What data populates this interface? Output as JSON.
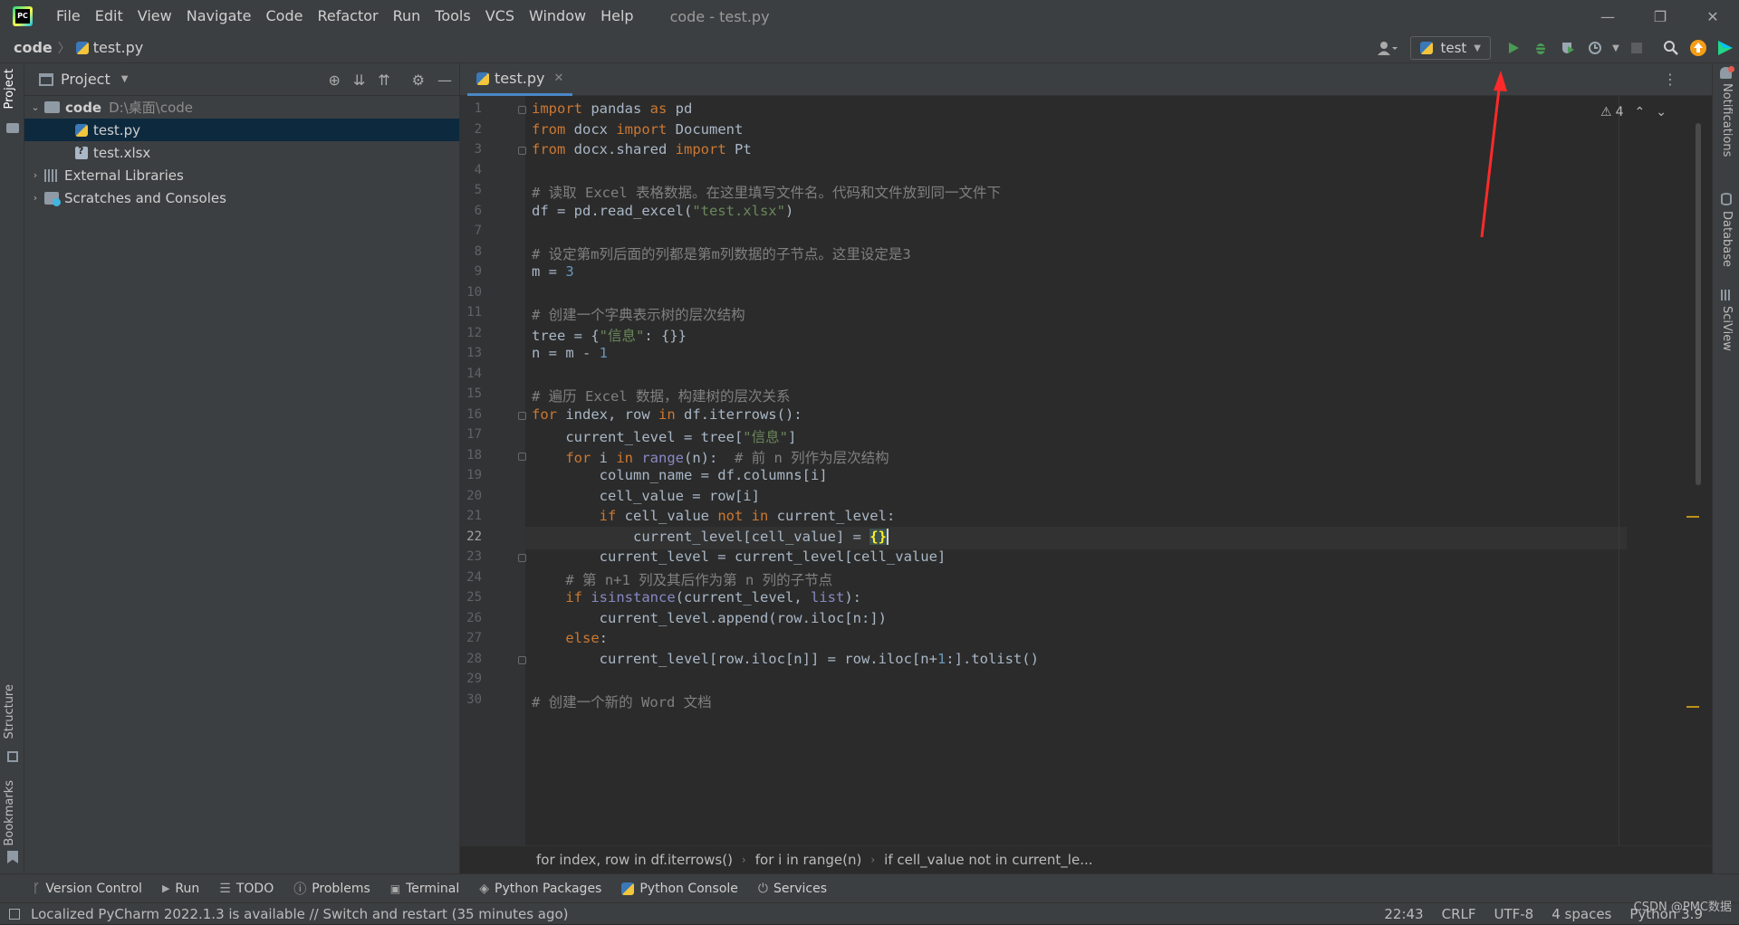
{
  "window": {
    "menu": [
      "File",
      "Edit",
      "View",
      "Navigate",
      "Code",
      "Refactor",
      "Run",
      "Tools",
      "VCS",
      "Window",
      "Help"
    ],
    "title": "code - test.py",
    "controls": [
      "—",
      "❐",
      "✕"
    ]
  },
  "navbar": {
    "root": "code",
    "file": "test.py",
    "run_config": "test"
  },
  "left_strip": {
    "project": "Project",
    "structure": "Structure",
    "bookmarks": "Bookmarks"
  },
  "project_panel": {
    "title": "Project",
    "tree": {
      "root_name": "code",
      "root_path": "D:\\桌面\\code",
      "file1": "test.py",
      "file2": "test.xlsx",
      "libs": "External Libraries",
      "scratches": "Scratches and Consoles"
    }
  },
  "editor": {
    "tab": "test.py",
    "current_line": 22,
    "warnings": "4",
    "lines": [
      "import pandas as pd",
      "from docx import Document",
      "from docx.shared import Pt",
      "",
      "# 读取 Excel 表格数据。在这里填写文件名。代码和文件放到同一文件下",
      "df = pd.read_excel(\"test.xlsx\")",
      "",
      "# 设定第m列后面的列都是第m列数据的子节点。这里设定是3",
      "m = 3",
      "",
      "# 创建一个字典表示树的层次结构",
      "tree = {\"信息\": {}}",
      "n = m - 1",
      "",
      "# 遍历 Excel 数据，构建树的层次关系",
      "for index, row in df.iterrows():",
      "    current_level = tree[\"信息\"]",
      "    for i in range(n):  # 前 n 列作为层次结构",
      "        column_name = df.columns[i]",
      "        cell_value = row[i]",
      "        if cell_value not in current_level:",
      "            current_level[cell_value] = {}",
      "        current_level = current_level[cell_value]",
      "    # 第 n+1 列及其后作为第 n 列的子节点",
      "    if isinstance(current_level, list):",
      "        current_level.append(row.iloc[n:])",
      "    else:",
      "        current_level[row.iloc[n]] = row.iloc[n+1:].tolist()",
      "",
      "# 创建一个新的 Word 文档"
    ]
  },
  "breadcrumbs": [
    "for index, row in df.iterrows()",
    "for i in range(n)",
    "if cell_value not in current_le..."
  ],
  "right_strip": {
    "notifications": "Notifications",
    "database": "Database",
    "sciview": "SciView"
  },
  "tool_tabs": [
    "Version Control",
    "Run",
    "TODO",
    "Problems",
    "Terminal",
    "Python Packages",
    "Python Console",
    "Services"
  ],
  "status": {
    "message": "Localized PyCharm 2022.1.3 is available // Switch and restart (35 minutes ago)",
    "position": "22:43",
    "line_sep": "CRLF",
    "encoding": "UTF-8",
    "indent": "4 spaces",
    "interpreter": "Python 3.9"
  },
  "watermark": "CSDN @PMC数据",
  "colors": {
    "accent": "#4a88c7",
    "run": "#499c54",
    "annotation_arrow": "#ff2a2a"
  }
}
